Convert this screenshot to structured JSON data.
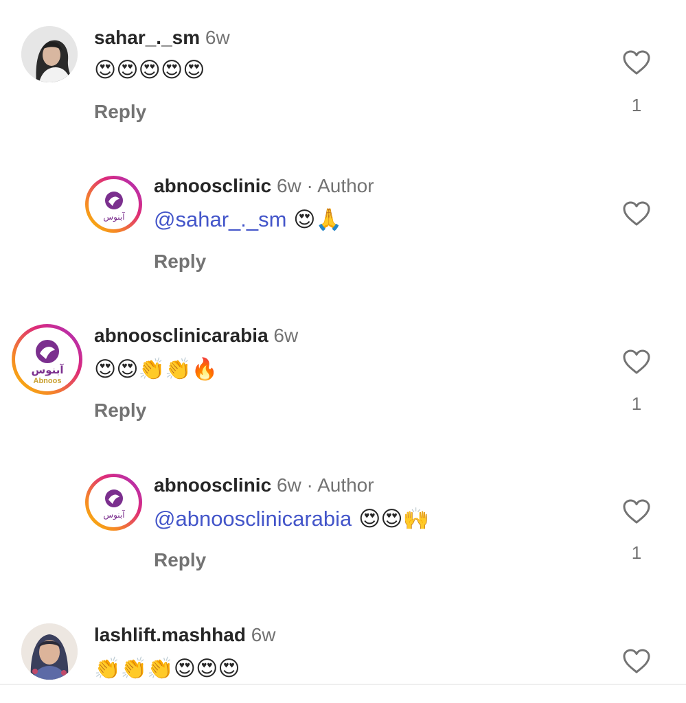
{
  "comments": [
    {
      "username": "sahar_._sm",
      "time": "6w",
      "body": "😍😍😍😍😍",
      "reply_label": "Reply",
      "likes": "1"
    },
    {
      "username": "abnoosclinic",
      "time": "6w",
      "separator": "·",
      "author_label": "Author",
      "mention": "@sahar_._sm",
      "body": " 😍🙏",
      "reply_label": "Reply"
    },
    {
      "username": "abnoosclinicarabia",
      "time": "6w",
      "body": "😍😍👏👏🔥",
      "reply_label": "Reply",
      "likes": "1"
    },
    {
      "username": "abnoosclinic",
      "time": "6w",
      "separator": "·",
      "author_label": "Author",
      "mention": "@abnoosclinicarabia",
      "body": " 😍😍🙌",
      "reply_label": "Reply",
      "likes": "1"
    },
    {
      "username": "lashlift.mashhad",
      "time": "6w",
      "body": "👏👏👏😍😍😍"
    }
  ],
  "logo": {
    "arabic_text": "آبنوس",
    "latin_text": "Abnoos"
  },
  "colors": {
    "mention": "#4355c9",
    "secondary_text": "#737373",
    "primary_text": "#262626",
    "logo_purple": "#7b2f8e"
  },
  "icons": {
    "like": "heart-outline-icon"
  }
}
